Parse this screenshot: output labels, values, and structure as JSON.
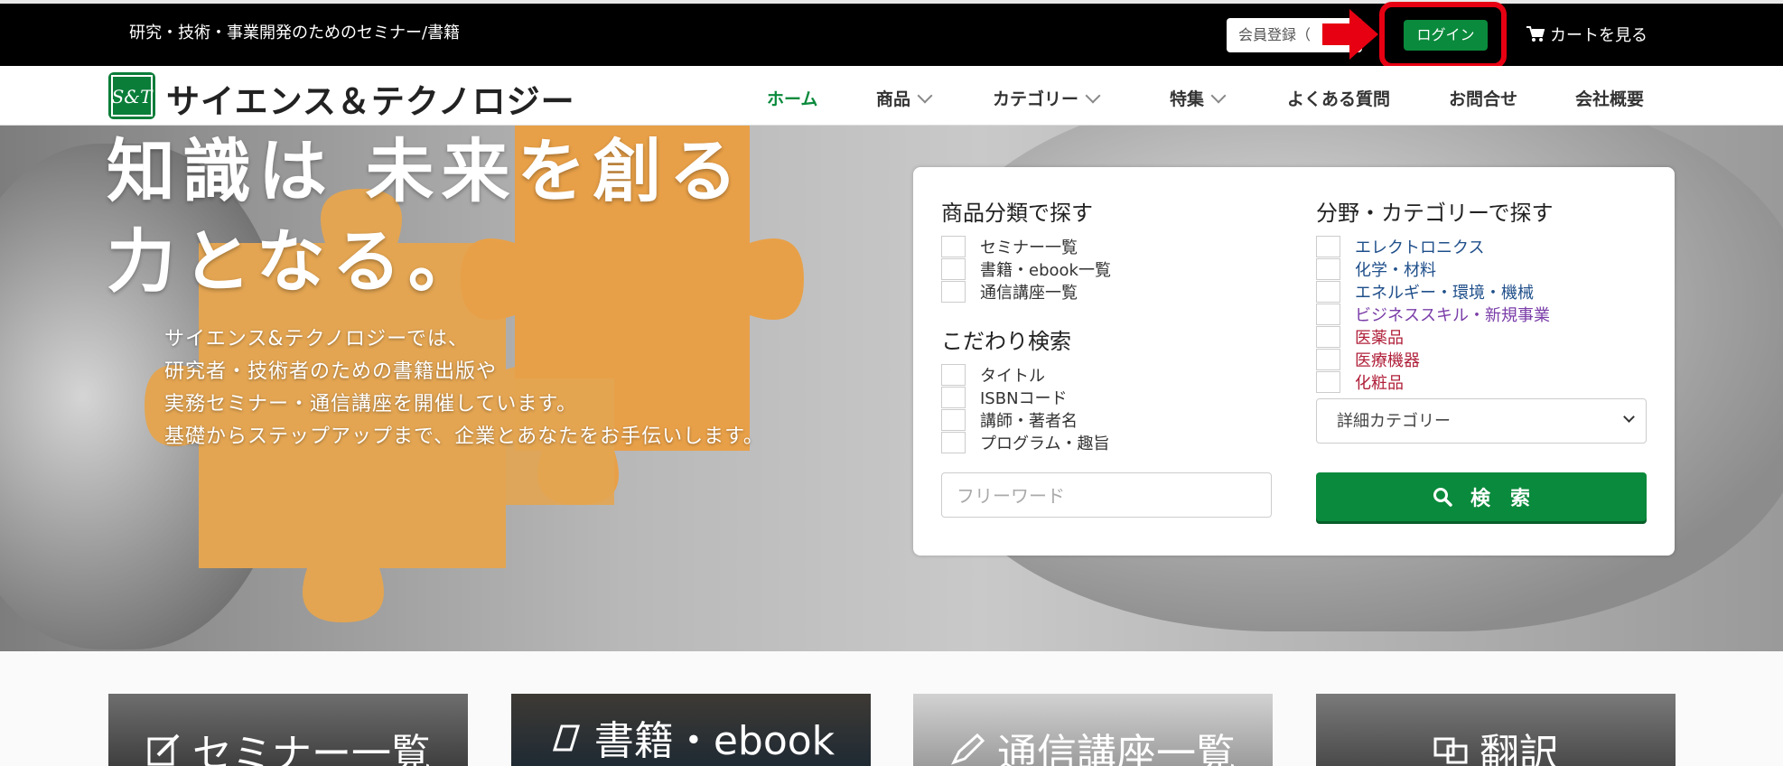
{
  "topbar": {
    "tagline": "研究・技術・事業開発のためのセミナー/書籍",
    "member_label": "会員登録（",
    "login_label": "ログイン",
    "cart_label": "カートを見る",
    "icons": {
      "cart": "cart-icon",
      "arrow": "right-arrow-icon"
    },
    "colors": {
      "bg": "#000000",
      "login_bg": "#0a8a3c",
      "highlight": "#e60012"
    }
  },
  "logo": {
    "mark_text": "S&T",
    "name": "サイエンス＆テクノロジー"
  },
  "nav": {
    "items": [
      {
        "label": "ホーム",
        "active": true,
        "dropdown": false
      },
      {
        "label": "商品",
        "active": false,
        "dropdown": true
      },
      {
        "label": "カテゴリー",
        "active": false,
        "dropdown": true
      },
      {
        "label": "特集",
        "active": false,
        "dropdown": true
      },
      {
        "label": "よくある質問",
        "active": false,
        "dropdown": false
      },
      {
        "label": "お問合せ",
        "active": false,
        "dropdown": false
      },
      {
        "label": "会社概要",
        "active": false,
        "dropdown": false
      }
    ]
  },
  "hero": {
    "title_line1": "知識は 未来を創る",
    "title_line2": "力となる。",
    "desc_line1": "サイエンス&テクノロジーでは、",
    "desc_line2": "研究者・技術者のための書籍出版や",
    "desc_line3": "実務セミナー・通信講座を開催しています。",
    "desc_line4": "基礎からステップアップまで、企業とあなたをお手伝いします。"
  },
  "search_panel": {
    "product_heading": "商品分類で探す",
    "product_options": [
      "セミナー一覧",
      "書籍・ebook一覧",
      "通信講座一覧"
    ],
    "detail_heading": "こだわり検索",
    "detail_options": [
      "タイトル",
      "ISBNコード",
      "講師・著者名",
      "プログラム・趣旨"
    ],
    "category_heading": "分野・カテゴリーで探す",
    "category_options": [
      "エレクトロニクス",
      "化学・材料",
      "エネルギー・環境・機械",
      "ビジネススキル・新規事業",
      "医薬品",
      "医療機器",
      "化粧品"
    ],
    "subcategory_selected": "詳細カテゴリー",
    "freeword_placeholder": "フリーワード",
    "search_label": "検　索",
    "icons": {
      "search": "search-icon"
    }
  },
  "cards": [
    {
      "label": "セミナー一覧",
      "icon": "edit-icon"
    },
    {
      "label": "書籍・ebook",
      "icon": "book-icon"
    },
    {
      "label": "通信講座一覧",
      "icon": "pen-icon"
    },
    {
      "label": "翻訳",
      "icon": "translate-icon"
    }
  ]
}
